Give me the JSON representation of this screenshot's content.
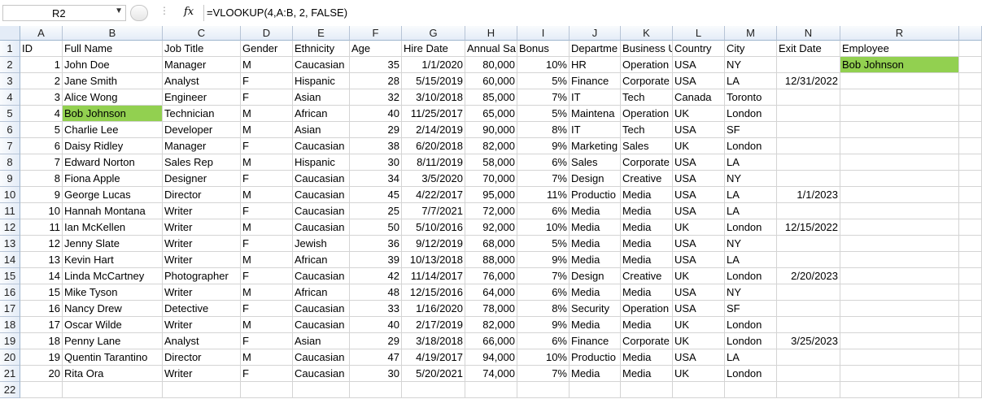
{
  "formula_bar": {
    "name_box": "R2",
    "fx_label": "fx",
    "formula": "=VLOOKUP(4,A:B, 2, FALSE)"
  },
  "colors": {
    "highlight": "#92d050",
    "header_bg": "#e4ecf7"
  },
  "columns": [
    "A",
    "B",
    "C",
    "D",
    "E",
    "F",
    "G",
    "H",
    "I",
    "J",
    "K",
    "L",
    "M",
    "N",
    "R"
  ],
  "rows": [
    [
      "ID",
      "Full Name",
      "Job Title",
      "Gender",
      "Ethnicity",
      "Age",
      "Hire Date",
      "Annual Sa",
      "Bonus",
      "Departme",
      "Business U",
      "Country",
      "City",
      "Exit Date",
      "Employee"
    ],
    [
      "1",
      "John Doe",
      "Manager",
      "M",
      "Caucasian",
      "35",
      "1/1/2020",
      "80,000",
      "10%",
      "HR",
      "Operation",
      "USA",
      "NY",
      "",
      "Bob Johnson"
    ],
    [
      "2",
      "Jane Smith",
      "Analyst",
      "F",
      "Hispanic",
      "28",
      "5/15/2019",
      "60,000",
      "5%",
      "Finance",
      "Corporate",
      "USA",
      "LA",
      "12/31/2022",
      ""
    ],
    [
      "3",
      "Alice Wong",
      "Engineer",
      "F",
      "Asian",
      "32",
      "3/10/2018",
      "85,000",
      "7%",
      "IT",
      "Tech",
      "Canada",
      "Toronto",
      "",
      ""
    ],
    [
      "4",
      "Bob Johnson",
      "Technician",
      "M",
      "African",
      "40",
      "11/25/2017",
      "65,000",
      "5%",
      "Maintena",
      "Operation",
      "UK",
      "London",
      "",
      ""
    ],
    [
      "5",
      "Charlie Lee",
      "Developer",
      "M",
      "Asian",
      "29",
      "2/14/2019",
      "90,000",
      "8%",
      "IT",
      "Tech",
      "USA",
      "SF",
      "",
      ""
    ],
    [
      "6",
      "Daisy Ridley",
      "Manager",
      "F",
      "Caucasian",
      "38",
      "6/20/2018",
      "82,000",
      "9%",
      "Marketing",
      "Sales",
      "UK",
      "London",
      "",
      ""
    ],
    [
      "7",
      "Edward Norton",
      "Sales Rep",
      "M",
      "Hispanic",
      "30",
      "8/11/2019",
      "58,000",
      "6%",
      "Sales",
      "Corporate",
      "USA",
      "LA",
      "",
      ""
    ],
    [
      "8",
      "Fiona Apple",
      "Designer",
      "F",
      "Caucasian",
      "34",
      "3/5/2020",
      "70,000",
      "7%",
      "Design",
      "Creative",
      "USA",
      "NY",
      "",
      ""
    ],
    [
      "9",
      "George Lucas",
      "Director",
      "M",
      "Caucasian",
      "45",
      "4/22/2017",
      "95,000",
      "11%",
      "Productio",
      "Media",
      "USA",
      "LA",
      "1/1/2023",
      ""
    ],
    [
      "10",
      "Hannah Montana",
      "Writer",
      "F",
      "Caucasian",
      "25",
      "7/7/2021",
      "72,000",
      "6%",
      "Media",
      "Media",
      "USA",
      "LA",
      "",
      ""
    ],
    [
      "11",
      "Ian McKellen",
      "Writer",
      "M",
      "Caucasian",
      "50",
      "5/10/2016",
      "92,000",
      "10%",
      "Media",
      "Media",
      "UK",
      "London",
      "12/15/2022",
      ""
    ],
    [
      "12",
      "Jenny Slate",
      "Writer",
      "F",
      "Jewish",
      "36",
      "9/12/2019",
      "68,000",
      "5%",
      "Media",
      "Media",
      "USA",
      "NY",
      "",
      ""
    ],
    [
      "13",
      "Kevin Hart",
      "Writer",
      "M",
      "African",
      "39",
      "10/13/2018",
      "88,000",
      "9%",
      "Media",
      "Media",
      "USA",
      "LA",
      "",
      ""
    ],
    [
      "14",
      "Linda McCartney",
      "Photographer",
      "F",
      "Caucasian",
      "42",
      "11/14/2017",
      "76,000",
      "7%",
      "Design",
      "Creative",
      "UK",
      "London",
      "2/20/2023",
      ""
    ],
    [
      "15",
      "Mike Tyson",
      "Writer",
      "M",
      "African",
      "48",
      "12/15/2016",
      "64,000",
      "6%",
      "Media",
      "Media",
      "USA",
      "NY",
      "",
      ""
    ],
    [
      "16",
      "Nancy Drew",
      "Detective",
      "F",
      "Caucasian",
      "33",
      "1/16/2020",
      "78,000",
      "8%",
      "Security",
      "Operation",
      "USA",
      "SF",
      "",
      ""
    ],
    [
      "17",
      "Oscar Wilde",
      "Writer",
      "M",
      "Caucasian",
      "40",
      "2/17/2019",
      "82,000",
      "9%",
      "Media",
      "Media",
      "UK",
      "London",
      "",
      ""
    ],
    [
      "18",
      "Penny Lane",
      "Analyst",
      "F",
      "Asian",
      "29",
      "3/18/2018",
      "66,000",
      "6%",
      "Finance",
      "Corporate",
      "UK",
      "London",
      "3/25/2023",
      ""
    ],
    [
      "19",
      "Quentin Tarantino",
      "Director",
      "M",
      "Caucasian",
      "47",
      "4/19/2017",
      "94,000",
      "10%",
      "Productio",
      "Media",
      "USA",
      "LA",
      "",
      ""
    ],
    [
      "20",
      "Rita Ora",
      "Writer",
      "F",
      "Caucasian",
      "30",
      "5/20/2021",
      "74,000",
      "7%",
      "Media",
      "Media",
      "UK",
      "London",
      "",
      ""
    ],
    [
      "",
      "",
      "",
      "",
      "",
      "",
      "",
      "",
      "",
      "",
      "",
      "",
      "",
      "",
      ""
    ]
  ]
}
